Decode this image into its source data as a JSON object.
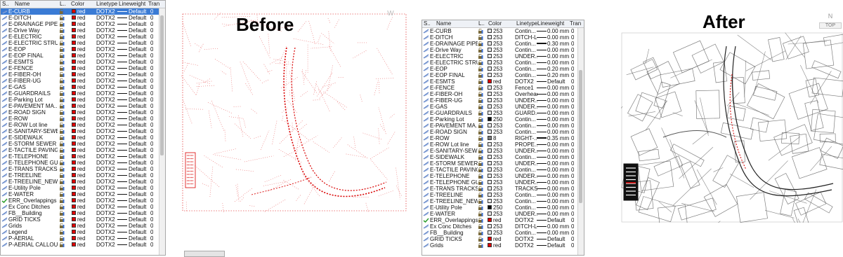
{
  "left_panel": {
    "headers": [
      "S..",
      "Name",
      "L..",
      "Color",
      "Linetype",
      "Lineweight",
      "Tran"
    ],
    "rows": [
      {
        "name": "E-CURB",
        "color": "red",
        "lt": "DOTX2",
        "lw": "Default",
        "tr": "0",
        "sel": true
      },
      {
        "name": "E-DITCH",
        "color": "red",
        "lt": "DOTX2",
        "lw": "Default",
        "tr": "0"
      },
      {
        "name": "E-DRAINAGE PIPE",
        "color": "red",
        "lt": "DOTX2",
        "lw": "Default",
        "tr": "0"
      },
      {
        "name": "E-Drive Way",
        "color": "red",
        "lt": "DOTX2",
        "lw": "Default",
        "tr": "0"
      },
      {
        "name": "E-ELECTRIC",
        "color": "red",
        "lt": "DOTX2",
        "lw": "Default",
        "tr": "0"
      },
      {
        "name": "E-ELECTRIC STRU...",
        "color": "red",
        "lt": "DOTX2",
        "lw": "Default",
        "tr": "0"
      },
      {
        "name": "E-EOP",
        "color": "red",
        "lt": "DOTX2",
        "lw": "Default",
        "tr": "0"
      },
      {
        "name": "E-EOP FINAL",
        "color": "red",
        "lt": "DOTX2",
        "lw": "Default",
        "tr": "0"
      },
      {
        "name": "E-ESMTS",
        "color": "red",
        "lt": "DOTX2",
        "lw": "Default",
        "tr": "0"
      },
      {
        "name": "E-FENCE",
        "color": "red",
        "lt": "DOTX2",
        "lw": "Default",
        "tr": "0"
      },
      {
        "name": "E-FIBER-OH",
        "color": "red",
        "lt": "DOTX2",
        "lw": "Default",
        "tr": "0"
      },
      {
        "name": "E-FIBER-UG",
        "color": "red",
        "lt": "DOTX2",
        "lw": "Default",
        "tr": "0"
      },
      {
        "name": "E-GAS",
        "color": "red",
        "lt": "DOTX2",
        "lw": "Default",
        "tr": "0"
      },
      {
        "name": "E-GUARDRAILS",
        "color": "red",
        "lt": "DOTX2",
        "lw": "Default",
        "tr": "0"
      },
      {
        "name": "E-Parking Lot",
        "color": "red",
        "lt": "DOTX2",
        "lw": "Default",
        "tr": "0"
      },
      {
        "name": "E-PAVEMENT MA...",
        "color": "red",
        "lt": "DOTX2",
        "lw": "Default",
        "tr": "0"
      },
      {
        "name": "E-ROAD SIGN",
        "color": "red",
        "lt": "DOTX2",
        "lw": "Default",
        "tr": "0"
      },
      {
        "name": "E-ROW",
        "color": "red",
        "lt": "DOTX2",
        "lw": "Default",
        "tr": "0"
      },
      {
        "name": "E-ROW Lot line",
        "color": "red",
        "lt": "DOTX2",
        "lw": "Default",
        "tr": "0"
      },
      {
        "name": "E-SANITARY-SEWER",
        "color": "red",
        "lt": "DOTX2",
        "lw": "Default",
        "tr": "0"
      },
      {
        "name": "E-SIDEWALK",
        "color": "red",
        "lt": "DOTX2",
        "lw": "Default",
        "tr": "0"
      },
      {
        "name": "E-STORM SEWER",
        "color": "red",
        "lt": "DOTX2",
        "lw": "Default",
        "tr": "0"
      },
      {
        "name": "E-TACTILE PAVING",
        "color": "red",
        "lt": "DOTX2",
        "lw": "Default",
        "tr": "0"
      },
      {
        "name": "E-TELEPHONE",
        "color": "red",
        "lt": "DOTX2",
        "lw": "Default",
        "tr": "0"
      },
      {
        "name": "E-TELEPHONE GU...",
        "color": "red",
        "lt": "DOTX2",
        "lw": "Default",
        "tr": "0"
      },
      {
        "name": "E-TRANS TRACKS",
        "color": "red",
        "lt": "DOTX2",
        "lw": "Default",
        "tr": "0"
      },
      {
        "name": "E-TREELINE",
        "color": "red",
        "lt": "DOTX2",
        "lw": "Default",
        "tr": "0"
      },
      {
        "name": "E-TREELINE_NEW",
        "color": "red",
        "lt": "DOTX2",
        "lw": "Default",
        "tr": "0"
      },
      {
        "name": "E-Utility Pole",
        "color": "red",
        "lt": "DOTX2",
        "lw": "Default",
        "tr": "0"
      },
      {
        "name": "E-WATER",
        "color": "red",
        "lt": "DOTX2",
        "lw": "Default",
        "tr": "0"
      },
      {
        "name": "ERR_Overlappings",
        "color": "red",
        "lt": "DOTX2",
        "lw": "Default",
        "tr": "0",
        "check": true
      },
      {
        "name": "Ex Conc Ditches",
        "color": "red",
        "lt": "DOTX2",
        "lw": "Default",
        "tr": "0"
      },
      {
        "name": "FB__Building",
        "color": "red",
        "lt": "DOTX2",
        "lw": "Default",
        "tr": "0"
      },
      {
        "name": "GRID TICKS",
        "color": "red",
        "lt": "DOTX2",
        "lw": "Default",
        "tr": "0"
      },
      {
        "name": "Grids",
        "color": "red",
        "lt": "DOTX2",
        "lw": "Default",
        "tr": "0"
      },
      {
        "name": "Legend",
        "color": "red",
        "lt": "DOTX2",
        "lw": "Default",
        "tr": "0"
      },
      {
        "name": "P-AERIAL",
        "color": "red",
        "lt": "DOTX2",
        "lw": "Default",
        "tr": "0"
      },
      {
        "name": "P-AERIAL CALLOUT",
        "color": "red",
        "lt": "DOTX2",
        "lw": "Default",
        "tr": "0"
      }
    ]
  },
  "right_panel": {
    "headers": [
      "S..",
      "Name",
      "L..",
      "Color",
      "Linetype",
      "Lineweight",
      "Tran"
    ],
    "rows": [
      {
        "name": "E-CURB",
        "color": "253",
        "lt": "Contin...",
        "lw": "0.00 mm",
        "tr": "0"
      },
      {
        "name": "E-DITCH",
        "color": "253",
        "lt": "DITCH-L...",
        "lw": "0.00 mm",
        "tr": "0"
      },
      {
        "name": "E-DRAINAGE PIPE",
        "color": "253",
        "lt": "Contin...",
        "lw": "0.30 mm",
        "tr": "0"
      },
      {
        "name": "E-Drive Way",
        "color": "253",
        "lt": "Contin...",
        "lw": "0.00 mm",
        "tr": "0"
      },
      {
        "name": "E-ELECTRIC",
        "color": "253",
        "lt": "UNDER...",
        "lw": "0.00 mm",
        "tr": "0"
      },
      {
        "name": "E-ELECTRIC STRU...",
        "color": "253",
        "lt": "Contin...",
        "lw": "0.00 mm",
        "tr": "0"
      },
      {
        "name": "E-EOP",
        "color": "253",
        "lt": "Contin...",
        "lw": "0.20 mm",
        "tr": "0"
      },
      {
        "name": "E-EOP FINAL",
        "color": "253",
        "lt": "Contin...",
        "lw": "0.20 mm",
        "tr": "0"
      },
      {
        "name": "E-ESMTS",
        "color": "red",
        "lt": "DOTX2",
        "lw": "Default",
        "tr": "0"
      },
      {
        "name": "E-FENCE",
        "color": "253",
        "lt": "Fence1",
        "lw": "0.00 mm",
        "tr": "0"
      },
      {
        "name": "E-FIBER-OH",
        "color": "253",
        "lt": "Overhead",
        "lw": "0.00 mm",
        "tr": "0"
      },
      {
        "name": "E-FIBER-UG",
        "color": "253",
        "lt": "UNDER...",
        "lw": "0.00 mm",
        "tr": "0"
      },
      {
        "name": "E-GAS",
        "color": "253",
        "lt": "UNDER...",
        "lw": "0.00 mm",
        "tr": "0"
      },
      {
        "name": "E-GUARDRAILS",
        "color": "253",
        "lt": "GUARD...",
        "lw": "0.00 mm",
        "tr": "0"
      },
      {
        "name": "E-Parking Lot",
        "color": "250",
        "lt": "Contin...",
        "lw": "0.00 mm",
        "tr": "0"
      },
      {
        "name": "E-PAVEMENT MA...",
        "color": "253",
        "lt": "Contin...",
        "lw": "0.00 mm",
        "tr": "0"
      },
      {
        "name": "E-ROAD SIGN",
        "color": "253",
        "lt": "Contin...",
        "lw": "0.00 mm",
        "tr": "0"
      },
      {
        "name": "E-ROW",
        "color": "8",
        "lt": "RIGHT-...",
        "lw": "0.35 mm",
        "tr": "0"
      },
      {
        "name": "E-ROW Lot line",
        "color": "253",
        "lt": "PROPE...",
        "lw": "0.00 mm",
        "tr": "0"
      },
      {
        "name": "E-SANITARY-SEWER",
        "color": "253",
        "lt": "UNDER...",
        "lw": "0.00 mm",
        "tr": "0"
      },
      {
        "name": "E-SIDEWALK",
        "color": "253",
        "lt": "Contin...",
        "lw": "0.00 mm",
        "tr": "0"
      },
      {
        "name": "E-STORM SEWER",
        "color": "253",
        "lt": "UNDER...",
        "lw": "0.00 mm",
        "tr": "0"
      },
      {
        "name": "E-TACTILE PAVING",
        "color": "253",
        "lt": "Contin...",
        "lw": "0.00 mm",
        "tr": "0"
      },
      {
        "name": "E-TELEPHONE",
        "color": "253",
        "lt": "UNDER...",
        "lw": "0.00 mm",
        "tr": "0"
      },
      {
        "name": "E-TELEPHONE GU...",
        "color": "253",
        "lt": "UNDER...",
        "lw": "0.00 mm",
        "tr": "0"
      },
      {
        "name": "E-TRANS TRACKS",
        "color": "253",
        "lt": "TRACKS",
        "lw": "0.00 mm",
        "tr": "0"
      },
      {
        "name": "E-TREELINE",
        "color": "253",
        "lt": "Contin...",
        "lw": "0.00 mm",
        "tr": "0"
      },
      {
        "name": "E-TREELINE_NEW",
        "color": "253",
        "lt": "Contin...",
        "lw": "0.00 mm",
        "tr": "0"
      },
      {
        "name": "E-Utility Pole",
        "color": "250",
        "lt": "Contin...",
        "lw": "0.00 mm",
        "tr": "0"
      },
      {
        "name": "E-WATER",
        "color": "253",
        "lt": "UNDER...",
        "lw": "0.00 mm",
        "tr": "0"
      },
      {
        "name": "ERR_Overlappings",
        "color": "red",
        "lt": "DOTX2",
        "lw": "Default",
        "tr": "0",
        "check": true
      },
      {
        "name": "Ex Conc Ditches",
        "color": "253",
        "lt": "DITCH-L...",
        "lw": "0.00 mm",
        "tr": "0"
      },
      {
        "name": "FB__Building",
        "color": "253",
        "lt": "Contin...",
        "lw": "0.00 mm",
        "tr": "0"
      },
      {
        "name": "GRID TICKS",
        "color": "red",
        "lt": "DOTX2",
        "lw": "Default",
        "tr": "0"
      },
      {
        "name": "Grids",
        "color": "red",
        "lt": "DOTX2",
        "lw": "Default",
        "tr": "0"
      }
    ]
  },
  "labels": {
    "before": "Before",
    "after": "After"
  },
  "viewcube": {
    "north": "N",
    "top": "TOP",
    "west": "W"
  },
  "colors": {
    "red": "#e00000",
    "c253": "#e8e8e8",
    "c250": "#101010",
    "c8": "#808080",
    "select": "#3a7bd5",
    "cad_red": "#d90000",
    "cad_gray": "#555555"
  }
}
